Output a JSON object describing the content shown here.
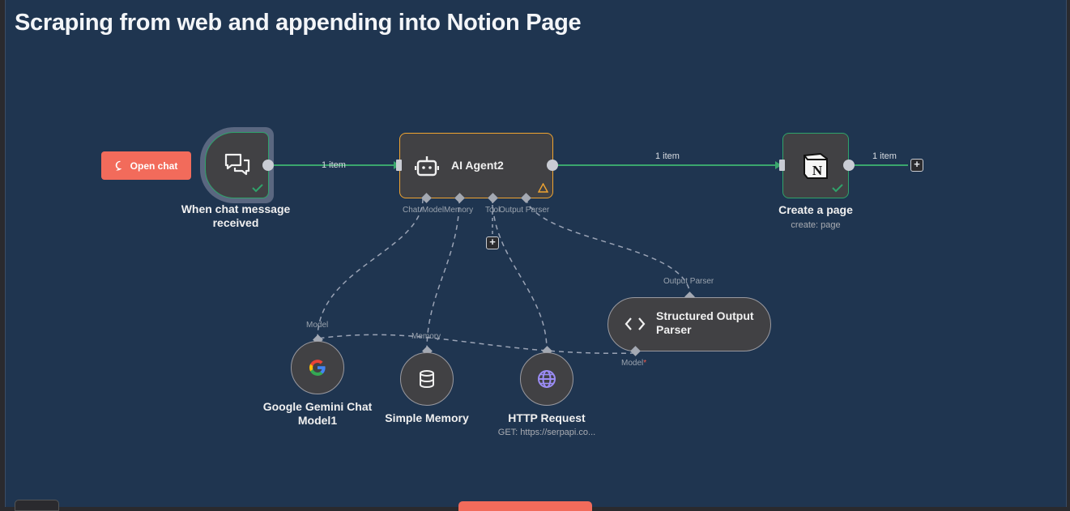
{
  "workflow_title": "Scraping from web and appending into Notion Page",
  "open_chat_label": "Open chat",
  "nodes": {
    "chat_trigger": {
      "label": "When chat message received"
    },
    "ai_agent": {
      "label": "AI Agent2",
      "ports": [
        "Chat Model",
        "Memory",
        "Tool",
        "Output Parser"
      ]
    },
    "create_page": {
      "label": "Create a page",
      "subtitle": "create: page"
    },
    "gemini": {
      "label": "Google Gemini Chat Model1",
      "port": "Model"
    },
    "memory": {
      "label": "Simple Memory",
      "port": "Memory"
    },
    "http": {
      "label": "HTTP Request",
      "subtitle": "GET: https://serpapi.co..."
    },
    "parser": {
      "label": "Structured Output Parser",
      "port_top": "Output Parser",
      "port_bottom": "Model"
    }
  },
  "connection_labels": {
    "trigger_to_agent": "1 item",
    "agent_to_page": "1 item",
    "page_out": "1 item"
  },
  "required_marker": "*",
  "colors": {
    "canvas": "#1f3550",
    "node": "#414144",
    "success": "#2fa36b",
    "warning": "#f0a431",
    "accent": "#f26b5b",
    "wire_main": "#3aa66d",
    "wire_sub": "#9aa3b5"
  },
  "icons": {
    "trigger": "chat-bubbles-icon",
    "agent": "robot-icon",
    "page": "notion-icon",
    "gemini": "google-g-icon",
    "memory": "database-icon",
    "http": "globe-icon",
    "parser": "code-brackets-icon"
  }
}
